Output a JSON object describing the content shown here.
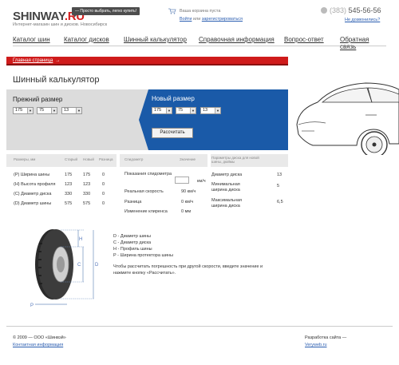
{
  "header": {
    "logo_main": "SHINWAY",
    "logo_suffix": ".RU",
    "logo_sub": "Интернет-магазин шин и дисков. Новосибирск",
    "slogan": "— Просто выбрать, легко купить!",
    "cart_text": "Ваша корзина пуста",
    "login_link": "Войти",
    "login_or": "или",
    "register_link": "зарегистрироваться",
    "phone_code": "(383)",
    "phone_number": "545-56-56",
    "callback_link": "Не дозвонились?"
  },
  "nav": {
    "items": [
      "Каталог шин",
      "Каталог дисков",
      "Шинный калькулятор",
      "Справочная информация",
      "Вопрос-ответ",
      "Обратная связь"
    ]
  },
  "breadcrumb": {
    "home": "Главная страница",
    "arrow": "→"
  },
  "page": {
    "title": "Шинный калькулятор"
  },
  "prev_size": {
    "label": "Прежний размер",
    "width": "175",
    "profile": "75",
    "diameter": "13"
  },
  "new_size": {
    "label": "Новый размер",
    "width": "175",
    "profile": "75",
    "diameter": "13",
    "button": "Рассчитать"
  },
  "size_table": {
    "headers": [
      "Размеры, мм",
      "Старый",
      "Новый",
      "Разница"
    ],
    "rows": [
      [
        "(P) Ширина шины",
        "175",
        "175",
        "0"
      ],
      [
        "(H) Высота профиля",
        "123",
        "123",
        "0"
      ],
      [
        "(C) Диаметр диска",
        "330",
        "330",
        "0"
      ],
      [
        "(D) Диаметр шины",
        "575",
        "575",
        "0"
      ]
    ]
  },
  "speed_table": {
    "headers": [
      "Спидометр",
      "Значение"
    ],
    "rows": [
      [
        "Показания спидометра",
        "км/ч"
      ],
      [
        "Реальная скорость",
        "90 км/ч"
      ],
      [
        "Разница",
        "0 км/ч"
      ],
      [
        "Изменение клиренса",
        "0 мм"
      ]
    ]
  },
  "disk_table": {
    "header": "Параметры диска для новой шины, дюймы",
    "rows": [
      [
        "Диаметр диска",
        "13"
      ],
      [
        "Минимальная ширина диска",
        "5"
      ],
      [
        "Максимальная ширина диска",
        "6,5"
      ]
    ]
  },
  "tire_labels": {
    "h": "H",
    "c": "C",
    "d": "D",
    "p": "P"
  },
  "legend": [
    "D - Диаметр шины",
    "C - Диаметр диска",
    "H - Профиль шины",
    "P - Ширина протектора шины"
  ],
  "note": "Чтобы рассчитать погрешность при другой скорости, введите значение и нажмите кнопку «Рассчитать».",
  "footer": {
    "copyright": "© 2009 — ООО «Шинвэй»",
    "contacts_link": "Контактная информация",
    "dev_label": "Разработка сайта —",
    "dev_link": "Veryweb.ru"
  },
  "colors": {
    "accent_red": "#cf1b1b",
    "accent_blue": "#1a5aa8",
    "link": "#2a5db0"
  }
}
